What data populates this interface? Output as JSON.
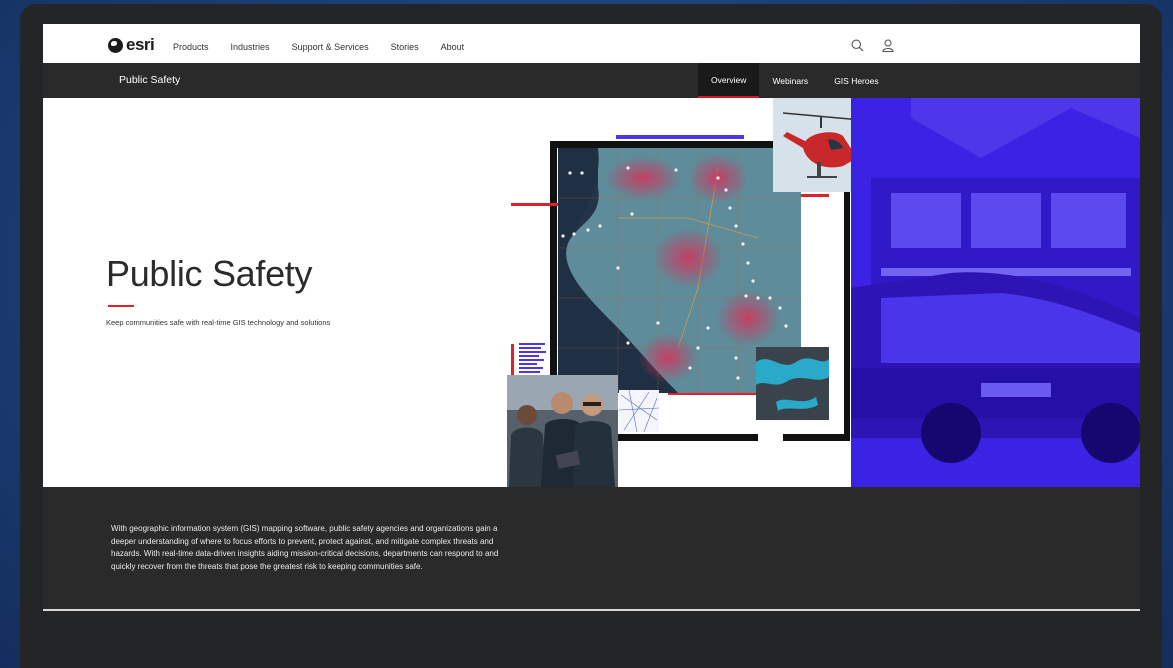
{
  "header": {
    "logo_text": "esri",
    "nav": [
      "Products",
      "Industries",
      "Support & Services",
      "Stories",
      "About"
    ],
    "icons": [
      "search-icon",
      "user-icon"
    ]
  },
  "subnav": {
    "title": "Public Safety",
    "tabs": [
      {
        "label": "Overview",
        "active": true
      },
      {
        "label": "Webinars",
        "active": false
      },
      {
        "label": "GIS Heroes",
        "active": false
      }
    ]
  },
  "hero": {
    "title": "Public Safety",
    "subtitle": "Keep communities safe with real-time GIS technology and solutions"
  },
  "intro": {
    "text": "With geographic information system (GIS) mapping software, public safety agencies and organizations gain a deeper understanding of where to focus efforts to prevent, protect against, and mitigate complex threats and hazards. With real-time data-driven insights aiding mission-critical decisions, departments can respond to and quickly recover from the threats that pose the greatest risk to keeping communities safe."
  },
  "colors": {
    "accent_red": "#e0212c",
    "brand_purple": "#3e24e6",
    "dark_bar": "#2a2a2a"
  }
}
